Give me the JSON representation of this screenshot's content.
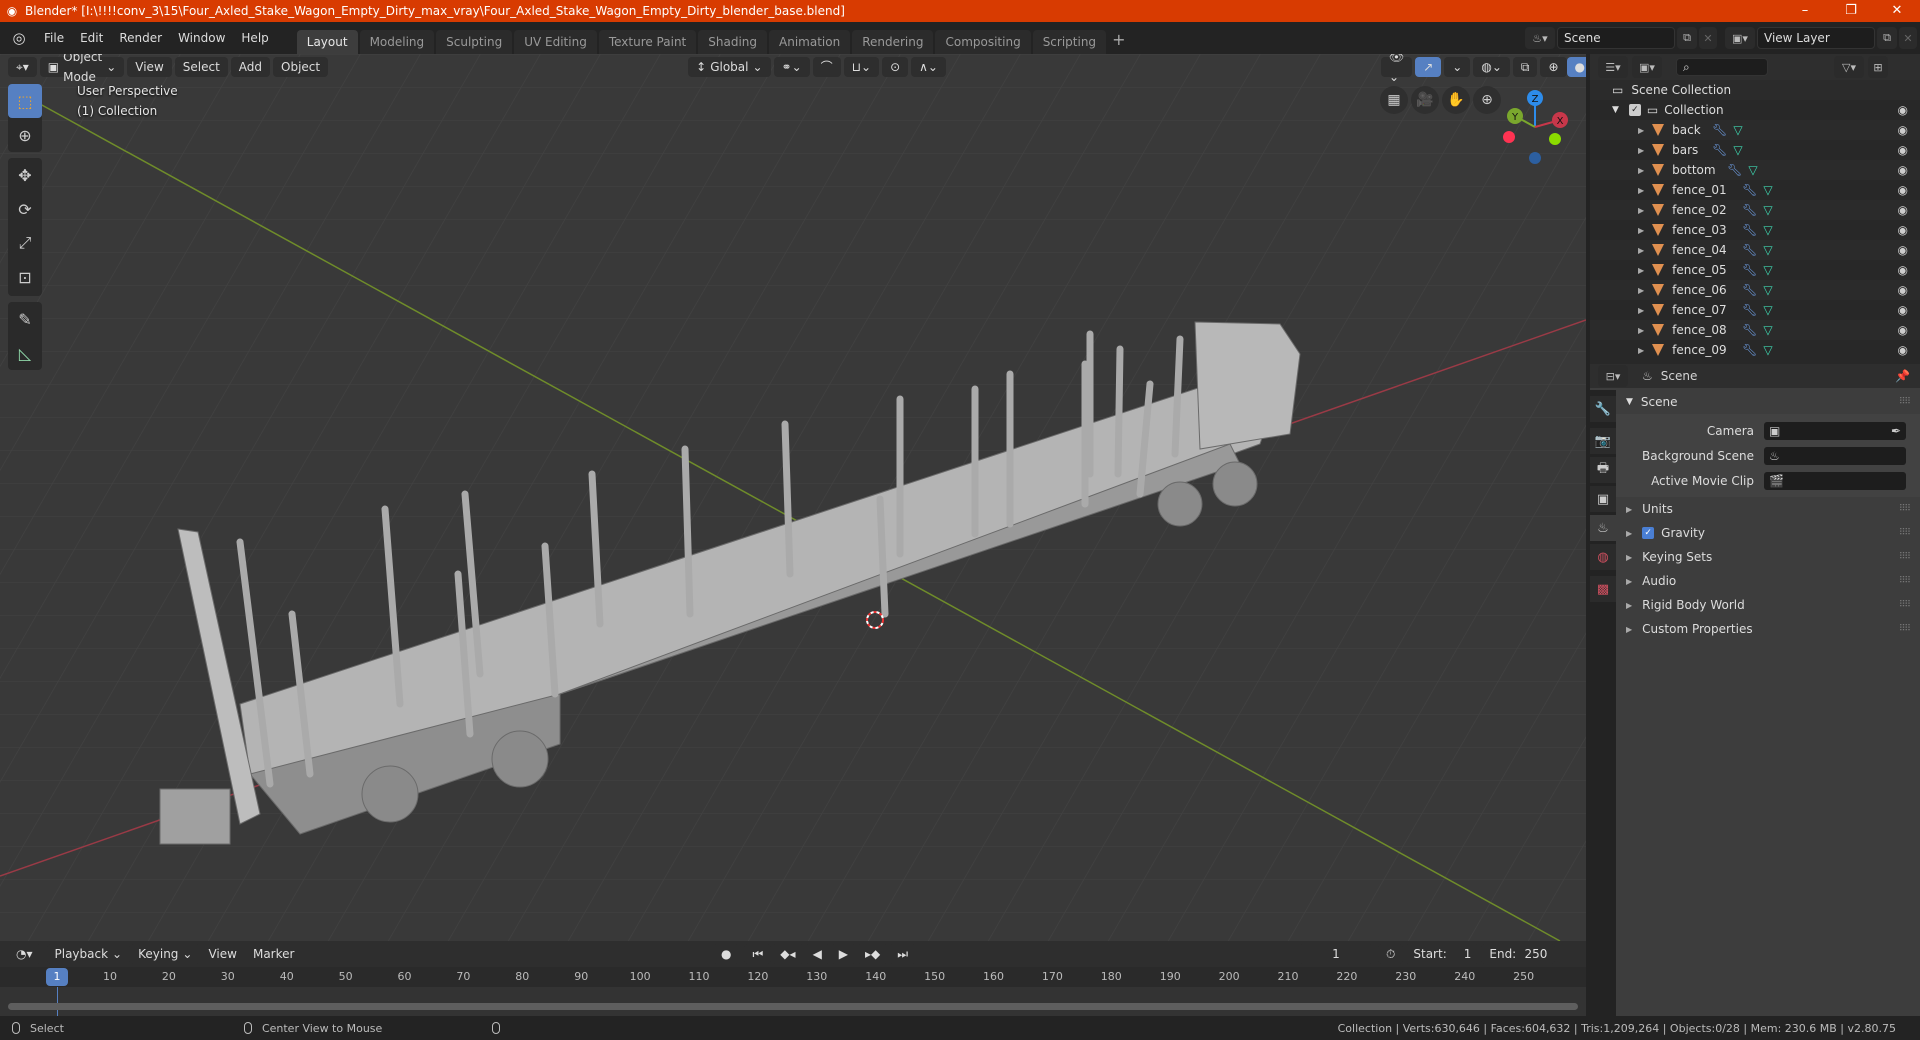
{
  "window": {
    "title": "Blender* [I:\\!!!!conv_3\\15\\Four_Axled_Stake_Wagon_Empty_Dirty_max_vray\\Four_Axled_Stake_Wagon_Empty_Dirty_blender_base.blend]",
    "controls": [
      "–",
      "❐",
      "✕"
    ]
  },
  "menubar": {
    "items": [
      "File",
      "Edit",
      "Render",
      "Window",
      "Help"
    ],
    "workspaces": [
      "Layout",
      "Modeling",
      "Sculpting",
      "UV Editing",
      "Texture Paint",
      "Shading",
      "Animation",
      "Rendering",
      "Compositing",
      "Scripting"
    ],
    "active_workspace": "Layout",
    "add_workspace": "+",
    "scene": "Scene",
    "view_layer": "View Layer"
  },
  "viewport": {
    "mode": "Object Mode",
    "menus": [
      "View",
      "Select",
      "Add",
      "Object"
    ],
    "transform_orientation": "Global",
    "overlay_title": "User Perspective",
    "overlay_subtitle": "(1) Collection",
    "gizmo_axes": [
      "X",
      "Y",
      "Z"
    ],
    "colors": {
      "x_axis": "#c8374a",
      "y_axis": "#7aa72d",
      "z_axis": "#2d8ceb",
      "accent": "#5680c2"
    }
  },
  "outliner": {
    "root": "Scene Collection",
    "collection": "Collection",
    "objects": [
      "back",
      "bars",
      "bottom",
      "fence_01",
      "fence_02",
      "fence_03",
      "fence_04",
      "fence_05",
      "fence_06",
      "fence_07",
      "fence_08",
      "fence_09"
    ]
  },
  "properties": {
    "context": "Scene",
    "panel_title": "Scene",
    "fields": [
      {
        "label": "Camera",
        "value": ""
      },
      {
        "label": "Background Scene",
        "value": ""
      },
      {
        "label": "Active Movie Clip",
        "value": ""
      }
    ],
    "sections": [
      {
        "label": "Units",
        "checkbox": false
      },
      {
        "label": "Gravity",
        "checkbox": true
      },
      {
        "label": "Keying Sets",
        "checkbox": false
      },
      {
        "label": "Audio",
        "checkbox": false
      },
      {
        "label": "Rigid Body World",
        "checkbox": false
      },
      {
        "label": "Custom Properties",
        "checkbox": false
      }
    ]
  },
  "timeline": {
    "menus": [
      "Playback",
      "Keying",
      "View",
      "Marker"
    ],
    "current_frame": "1",
    "start_label": "Start:",
    "start": "1",
    "end_label": "End:",
    "end": "250",
    "ticks": [
      "10",
      "20",
      "30",
      "40",
      "50",
      "60",
      "70",
      "80",
      "90",
      "100",
      "110",
      "120",
      "130",
      "140",
      "150",
      "160",
      "170",
      "180",
      "190",
      "200",
      "210",
      "220",
      "230",
      "240",
      "250"
    ]
  },
  "statusbar": {
    "left_action": "Select",
    "middle_action": "Center View to Mouse",
    "stats": "Collection | Verts:630,646 | Faces:604,632 | Tris:1,209,264 | Objects:0/28 | Mem: 230.6 MB | v2.80.75"
  }
}
